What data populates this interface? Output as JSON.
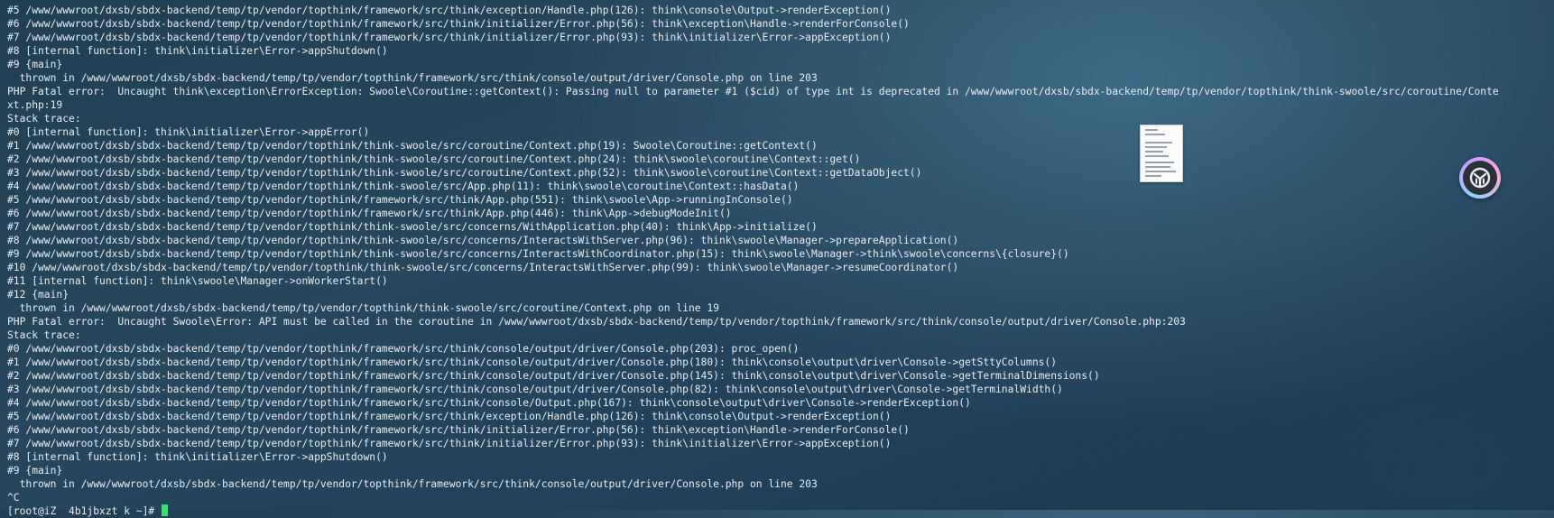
{
  "terminal": {
    "lines": [
      "#5 /www/wwwroot/dxsb/sbdx-backend/temp/tp/vendor/topthink/framework/src/think/exception/Handle.php(126): think\\console\\Output->renderException()",
      "#6 /www/wwwroot/dxsb/sbdx-backend/temp/tp/vendor/topthink/framework/src/think/initializer/Error.php(56): think\\exception\\Handle->renderForConsole()",
      "#7 /www/wwwroot/dxsb/sbdx-backend/temp/tp/vendor/topthink/framework/src/think/initializer/Error.php(93): think\\initializer\\Error->appException()",
      "#8 [internal function]: think\\initializer\\Error->appShutdown()",
      "#9 {main}",
      "  thrown in /www/wwwroot/dxsb/sbdx-backend/temp/tp/vendor/topthink/framework/src/think/console/output/driver/Console.php on line 203",
      "PHP Fatal error:  Uncaught think\\exception\\ErrorException: Swoole\\Coroutine::getContext(): Passing null to parameter #1 ($cid) of type int is deprecated in /www/wwwroot/dxsb/sbdx-backend/temp/tp/vendor/topthink/think-swoole/src/coroutine/Conte",
      "xt.php:19",
      "Stack trace:",
      "#0 [internal function]: think\\initializer\\Error->appError()",
      "#1 /www/wwwroot/dxsb/sbdx-backend/temp/tp/vendor/topthink/think-swoole/src/coroutine/Context.php(19): Swoole\\Coroutine::getContext()",
      "#2 /www/wwwroot/dxsb/sbdx-backend/temp/tp/vendor/topthink/think-swoole/src/coroutine/Context.php(24): think\\swoole\\coroutine\\Context::get()",
      "#3 /www/wwwroot/dxsb/sbdx-backend/temp/tp/vendor/topthink/think-swoole/src/coroutine/Context.php(52): think\\swoole\\coroutine\\Context::getDataObject()",
      "#4 /www/wwwroot/dxsb/sbdx-backend/temp/tp/vendor/topthink/think-swoole/src/App.php(11): think\\swoole\\coroutine\\Context::hasData()",
      "#5 /www/wwwroot/dxsb/sbdx-backend/temp/tp/vendor/topthink/framework/src/think/App.php(551): think\\swoole\\App->runningInConsole()",
      "#6 /www/wwwroot/dxsb/sbdx-backend/temp/tp/vendor/topthink/framework/src/think/App.php(446): think\\App->debugModeInit()",
      "#7 /www/wwwroot/dxsb/sbdx-backend/temp/tp/vendor/topthink/think-swoole/src/concerns/WithApplication.php(40): think\\App->initialize()",
      "#8 /www/wwwroot/dxsb/sbdx-backend/temp/tp/vendor/topthink/think-swoole/src/concerns/InteractsWithServer.php(96): think\\swoole\\Manager->prepareApplication()",
      "#9 /www/wwwroot/dxsb/sbdx-backend/temp/tp/vendor/topthink/think-swoole/src/concerns/InteractsWithCoordinator.php(15): think\\swoole\\Manager->think\\swoole\\concerns\\{closure}()",
      "#10 /www/wwwroot/dxsb/sbdx-backend/temp/tp/vendor/topthink/think-swoole/src/concerns/InteractsWithServer.php(99): think\\swoole\\Manager->resumeCoordinator()",
      "#11 [internal function]: think\\swoole\\Manager->onWorkerStart()",
      "#12 {main}",
      "  thrown in /www/wwwroot/dxsb/sbdx-backend/temp/tp/vendor/topthink/think-swoole/src/coroutine/Context.php on line 19",
      "PHP Fatal error:  Uncaught Swoole\\Error: API must be called in the coroutine in /www/wwwroot/dxsb/sbdx-backend/temp/tp/vendor/topthink/framework/src/think/console/output/driver/Console.php:203",
      "Stack trace:",
      "#0 /www/wwwroot/dxsb/sbdx-backend/temp/tp/vendor/topthink/framework/src/think/console/output/driver/Console.php(203): proc_open()",
      "#1 /www/wwwroot/dxsb/sbdx-backend/temp/tp/vendor/topthink/framework/src/think/console/output/driver/Console.php(180): think\\console\\output\\driver\\Console->getSttyColumns()",
      "#2 /www/wwwroot/dxsb/sbdx-backend/temp/tp/vendor/topthink/framework/src/think/console/output/driver/Console.php(145): think\\console\\output\\driver\\Console->getTerminalDimensions()",
      "#3 /www/wwwroot/dxsb/sbdx-backend/temp/tp/vendor/topthink/framework/src/think/console/output/driver/Console.php(82): think\\console\\output\\driver\\Console->getTerminalWidth()",
      "#4 /www/wwwroot/dxsb/sbdx-backend/temp/tp/vendor/topthink/framework/src/think/console/Output.php(167): think\\console\\output\\driver\\Console->renderException()",
      "#5 /www/wwwroot/dxsb/sbdx-backend/temp/tp/vendor/topthink/framework/src/think/exception/Handle.php(126): think\\console\\Output->renderException()",
      "#6 /www/wwwroot/dxsb/sbdx-backend/temp/tp/vendor/topthink/framework/src/think/initializer/Error.php(56): think\\exception\\Handle->renderForConsole()",
      "#7 /www/wwwroot/dxsb/sbdx-backend/temp/tp/vendor/topthink/framework/src/think/initializer/Error.php(93): think\\initializer\\Error->appException()",
      "#8 [internal function]: think\\initializer\\Error->appShutdown()",
      "#9 {main}",
      "  thrown in /www/wwwroot/dxsb/sbdx-backend/temp/tp/vendor/topthink/framework/src/think/console/output/driver/Console.php on line 203",
      "^C"
    ],
    "prompt": "[root@iZ  4b1jbxzt k ~]# "
  },
  "overlay": {
    "preview_icon": "document-thumbnail-icon",
    "widget_icon": "floating-assistant-icon"
  },
  "colors": {
    "text": "#e8edf2",
    "cursor": "#2ee66b",
    "background": "#26475d"
  }
}
